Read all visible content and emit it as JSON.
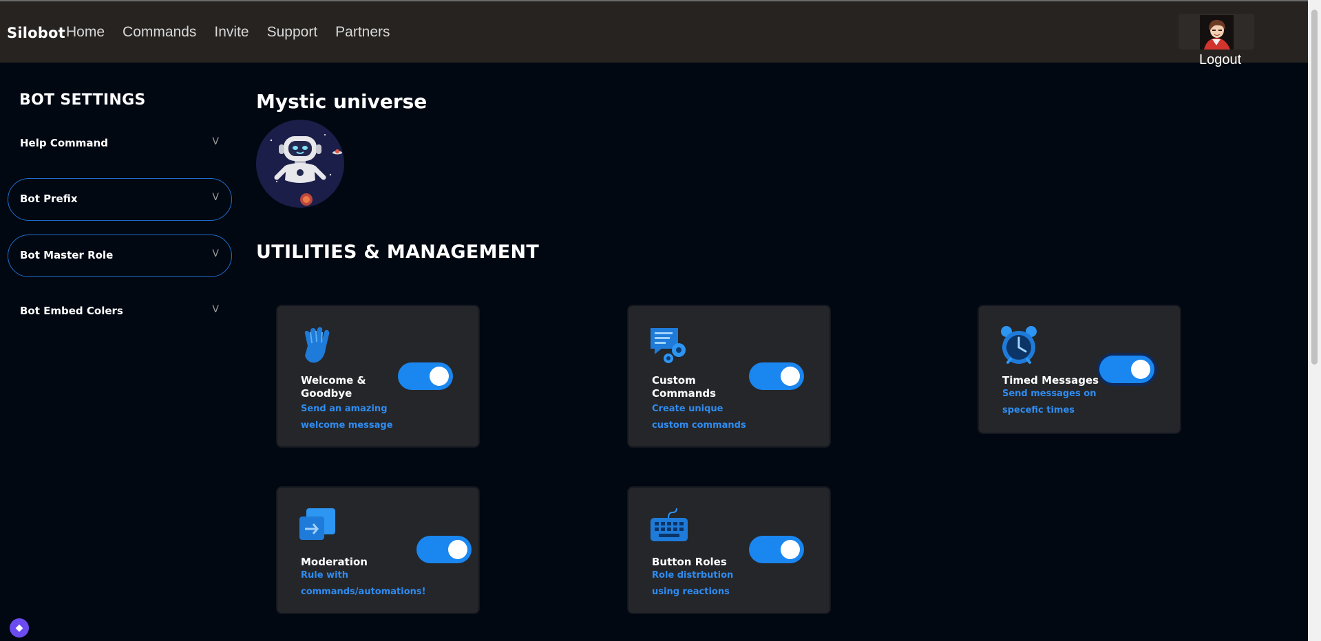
{
  "header": {
    "brand": "Silobot",
    "nav": [
      "Home",
      "Commands",
      "Invite",
      "Support",
      "Partners"
    ],
    "logout_label": "Logout"
  },
  "sidebar": {
    "title": "BOT SETTINGS",
    "items": [
      {
        "label": "Help Command",
        "chevron": "V",
        "outlined": false
      },
      {
        "label": "Bot Prefix",
        "chevron": "V",
        "outlined": true
      },
      {
        "label": "Bot Master Role",
        "chevron": "V",
        "outlined": true
      },
      {
        "label": "Bot Embed Colers",
        "chevron": "V",
        "outlined": false
      }
    ]
  },
  "server": {
    "name": "Mystic universe"
  },
  "section": {
    "title": "UTILITIES & MANAGEMENT"
  },
  "cards": [
    {
      "title": "Welcome & Goodbye",
      "description": "Send an amazing welcome message",
      "icon": "waving-hand-icon",
      "enabled": true
    },
    {
      "title": "Custom Commands",
      "description": "Create unique custom commands",
      "icon": "chat-gear-icon",
      "enabled": true
    },
    {
      "title": "Timed Messages",
      "description": "Send messages on specefic times",
      "icon": "alarm-clock-icon",
      "enabled": true
    },
    {
      "title": "Moderation",
      "description": "Rule with commands/automations!",
      "icon": "moderation-icon",
      "enabled": true
    },
    {
      "title": "Button Roles",
      "description": "Role distrbution using reactions",
      "icon": "keyboard-icon",
      "enabled": true
    }
  ],
  "colors": {
    "accent": "#1a86f0",
    "description": "#2f8cf0",
    "header_bg": "#262321",
    "page_bg": "#020812",
    "card_bg": "#24262a"
  }
}
